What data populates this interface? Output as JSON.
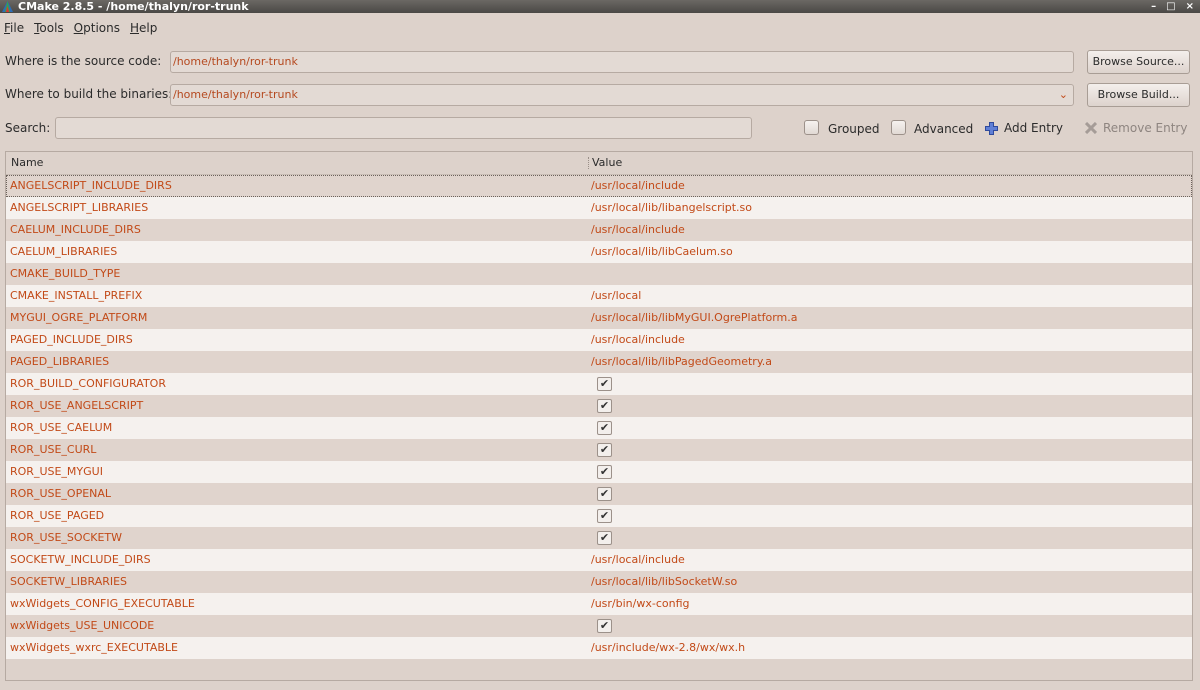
{
  "window": {
    "title": "CMake 2.8.5 - /home/thalyn/ror-trunk",
    "controls": [
      "–",
      "□",
      "×"
    ]
  },
  "menu": [
    {
      "mnemonic": "F",
      "rest": "ile"
    },
    {
      "mnemonic": "T",
      "rest": "ools"
    },
    {
      "mnemonic": "O",
      "rest": "ptions"
    },
    {
      "mnemonic": "H",
      "rest": "elp"
    }
  ],
  "source": {
    "label": "Where is the source code:",
    "value": "/home/thalyn/ror-trunk",
    "button": "Browse Source..."
  },
  "build": {
    "label": "Where to build the binaries:",
    "value": "/home/thalyn/ror-trunk",
    "dropdown_icon": "chevron-down-icon",
    "button": "Browse Build..."
  },
  "search": {
    "label": "Search:",
    "value": ""
  },
  "options": {
    "grouped": "Grouped",
    "advanced": "Advanced",
    "add_entry": "Add Entry",
    "remove_entry": "Remove Entry"
  },
  "table": {
    "columns": [
      "Name",
      "Value"
    ],
    "rows": [
      {
        "name": "ANGELSCRIPT_INCLUDE_DIRS",
        "value": "/usr/local/include"
      },
      {
        "name": "ANGELSCRIPT_LIBRARIES",
        "value": "/usr/local/lib/libangelscript.so"
      },
      {
        "name": "CAELUM_INCLUDE_DIRS",
        "value": "/usr/local/include"
      },
      {
        "name": "CAELUM_LIBRARIES",
        "value": "/usr/local/lib/libCaelum.so"
      },
      {
        "name": "CMAKE_BUILD_TYPE",
        "value": ""
      },
      {
        "name": "CMAKE_INSTALL_PREFIX",
        "value": "/usr/local"
      },
      {
        "name": "MYGUI_OGRE_PLATFORM",
        "value": "/usr/local/lib/libMyGUI.OgrePlatform.a"
      },
      {
        "name": "PAGED_INCLUDE_DIRS",
        "value": "/usr/local/include"
      },
      {
        "name": "PAGED_LIBRARIES",
        "value": "/usr/local/lib/libPagedGeometry.a"
      },
      {
        "name": "ROR_BUILD_CONFIGURATOR",
        "checked": true
      },
      {
        "name": "ROR_USE_ANGELSCRIPT",
        "checked": true
      },
      {
        "name": "ROR_USE_CAELUM",
        "checked": true
      },
      {
        "name": "ROR_USE_CURL",
        "checked": true
      },
      {
        "name": "ROR_USE_MYGUI",
        "checked": true
      },
      {
        "name": "ROR_USE_OPENAL",
        "checked": true
      },
      {
        "name": "ROR_USE_PAGED",
        "checked": true
      },
      {
        "name": "ROR_USE_SOCKETW",
        "checked": true
      },
      {
        "name": "SOCKETW_INCLUDE_DIRS",
        "value": "/usr/local/include"
      },
      {
        "name": "SOCKETW_LIBRARIES",
        "value": "/usr/local/lib/libSocketW.so"
      },
      {
        "name": "wxWidgets_CONFIG_EXECUTABLE",
        "value": "/usr/bin/wx-config"
      },
      {
        "name": "wxWidgets_USE_UNICODE",
        "checked": true
      },
      {
        "name": "wxWidgets_wxrc_EXECUTABLE",
        "value": "/usr/include/wx-2.8/wx/wx.h"
      }
    ]
  },
  "colors": {
    "background": "#ddd2cb",
    "value_text": "#c24a18",
    "row_alt": "#f5f1ee",
    "titlebar": "#4a4845"
  }
}
